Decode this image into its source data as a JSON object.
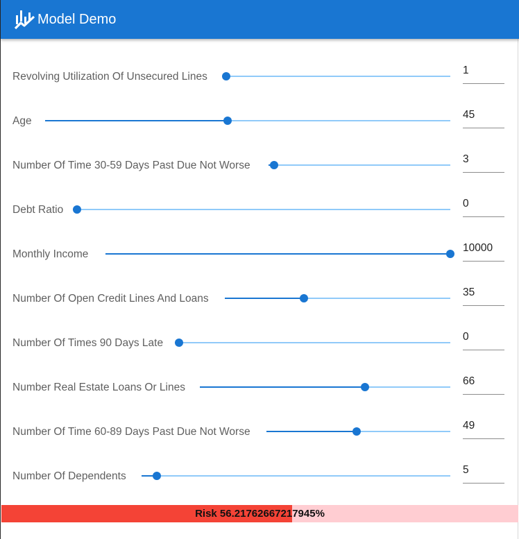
{
  "appbar": {
    "title": "Model Demo",
    "logo_icon": "line-chart-logo-icon",
    "color": "#1976d2"
  },
  "colors": {
    "slider": "#1976d2",
    "slider_rail": "#90caf9",
    "risk_fill": "#f44336",
    "risk_bg": "#ffcdd2"
  },
  "features": [
    {
      "label": "Revolving Utilization Of Unsecured Lines",
      "value": "1",
      "level": 0.0
    },
    {
      "label": "Age",
      "value": "45",
      "level": 0.45
    },
    {
      "label": "Number Of Time 30-59 Days Past Due Not Worse",
      "value": "3",
      "level": 0.03
    },
    {
      "label": "Debt Ratio",
      "value": "0",
      "level": 0.0
    },
    {
      "label": "Monthly Income",
      "value": "10000",
      "level": 1.0
    },
    {
      "label": "Number Of Open Credit Lines And Loans",
      "value": "35",
      "level": 0.35
    },
    {
      "label": "Number Of Times 90 Days Late",
      "value": "0",
      "level": 0.0
    },
    {
      "label": "Number Real Estate Loans Or Lines",
      "value": "66",
      "level": 0.66
    },
    {
      "label": "Number Of Time 60-89 Days Past Due Not Worse",
      "value": "49",
      "level": 0.49
    },
    {
      "label": "Number Of Dependents",
      "value": "5",
      "level": 0.05
    }
  ],
  "risk": {
    "text": "Risk 56.21762667217945%",
    "fraction": 0.5622
  }
}
